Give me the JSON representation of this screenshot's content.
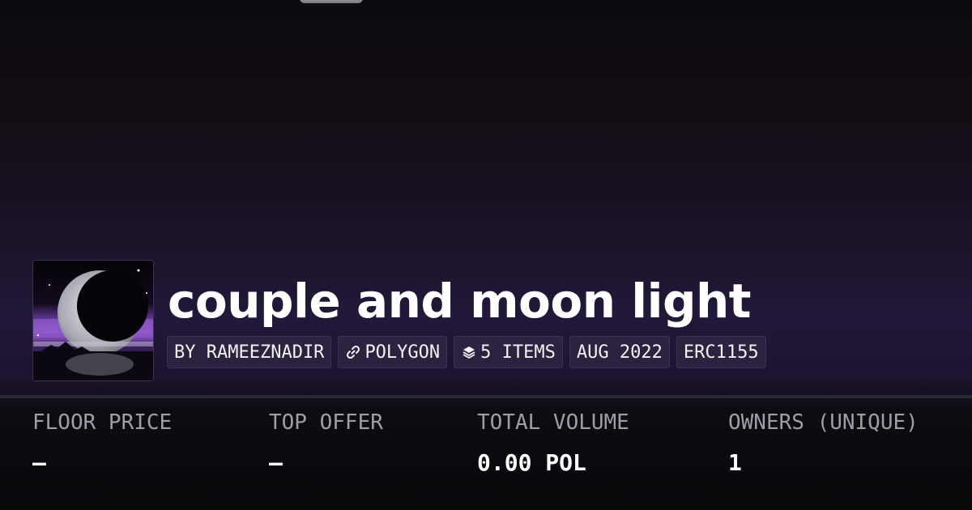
{
  "collection": {
    "title": "couple and moon light",
    "avatar_icon": "crescent-moon-artwork-icon"
  },
  "tags": {
    "creator": "BY RAMEEZNADIR",
    "chain": "POLYGON",
    "chain_icon": "link-icon",
    "items": "5 ITEMS",
    "items_icon": "layers-icon",
    "date": "AUG 2022",
    "standard": "ERC1155"
  },
  "stats": {
    "floor_price": {
      "label": "FLOOR PRICE",
      "value": "–"
    },
    "top_offer": {
      "label": "TOP OFFER",
      "value": "–"
    },
    "total_volume": {
      "label": "TOTAL VOLUME",
      "value": "0.00 POL"
    },
    "owners": {
      "label": "OWNERS (UNIQUE)",
      "value": "1"
    }
  },
  "colors": {
    "background_top": "#0c0b0f",
    "background_glow": "#22183a",
    "text_primary": "#ffffff",
    "text_muted": "#9f9ea6",
    "tag_background": "#1d1a24",
    "divider": "#2b2a30"
  }
}
